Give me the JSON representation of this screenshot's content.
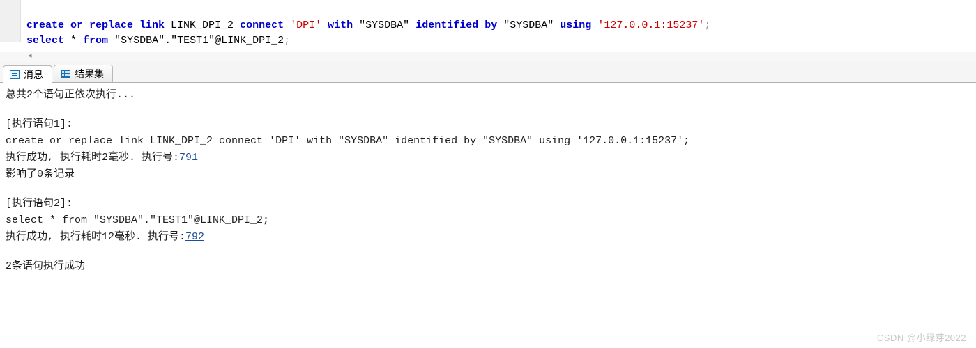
{
  "sql": {
    "line1": {
      "kw1": "create or replace link",
      "name": " LINK_DPI_2 ",
      "kw2": "connect",
      "sp1": " ",
      "str1": "'DPI'",
      "sp2": " ",
      "kw3": "with",
      "sp3": " ",
      "dq1": "\"SYSDBA\"",
      "sp4": " ",
      "kw4": "identified by",
      "sp5": " ",
      "dq2": "\"SYSDBA\"",
      "sp6": " ",
      "kw5": "using",
      "sp7": " ",
      "str2": "'127.0.0.1:15237'",
      "semi": ";"
    },
    "line2": {
      "kw1": "select",
      "rest": " * ",
      "kw2": "from",
      "sp1": " ",
      "dq1": "\"SYSDBA\".\"TEST1\"",
      "at": "@LINK_DPI_2",
      "semi": ";"
    }
  },
  "tabs": {
    "messages": "消息",
    "resultset": "结果集"
  },
  "output": {
    "header": "总共2个语句正依次执行...",
    "s1_label": "[执行语句1]:",
    "s1_sql": "create or replace link LINK_DPI_2 connect 'DPI' with \"SYSDBA\" identified by \"SYSDBA\" using '127.0.0.1:15237';",
    "s1_status_pre": "执行成功, 执行耗时2毫秒. 执行号:",
    "s1_exec_no": "791",
    "s1_rows": "影响了0条记录",
    "s2_label": "[执行语句2]:",
    "s2_sql": "select * from \"SYSDBA\".\"TEST1\"@LINK_DPI_2;",
    "s2_status_pre": "执行成功, 执行耗时12毫秒. 执行号:",
    "s2_exec_no": "792",
    "footer": "2条语句执行成功"
  },
  "watermark": "CSDN @小绿芽2022"
}
